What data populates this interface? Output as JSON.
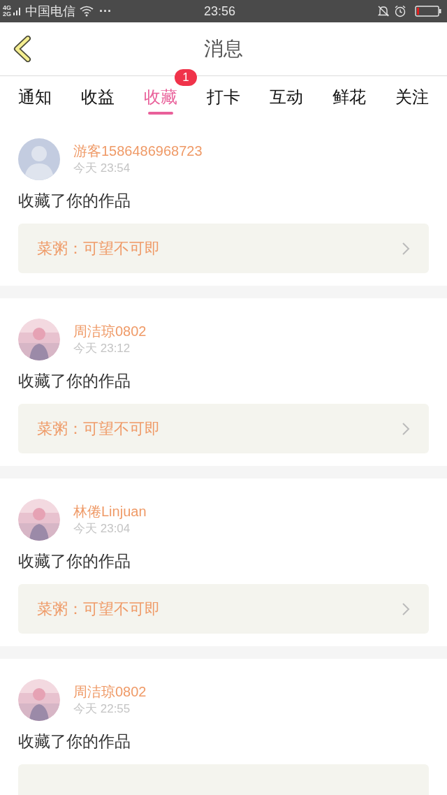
{
  "status_bar": {
    "network_top": "4G",
    "network_bottom": "2G",
    "carrier": "中国电信",
    "more": "···",
    "time": "23:56"
  },
  "header": {
    "title": "消息"
  },
  "tabs": [
    {
      "label": "通知",
      "selected": false
    },
    {
      "label": "收益",
      "selected": false
    },
    {
      "label": "收藏",
      "selected": true,
      "badge": "1"
    },
    {
      "label": "打卡",
      "selected": false
    },
    {
      "label": "互动",
      "selected": false
    },
    {
      "label": "鲜花",
      "selected": false
    },
    {
      "label": "关注",
      "selected": false
    }
  ],
  "messages": [
    {
      "avatar": {
        "kind": "default"
      },
      "name": "游客1586486968723",
      "time": "今天 23:54",
      "action": "收藏了你的作品",
      "work": "菜粥：可望不可即"
    },
    {
      "name": "周洁琼0802",
      "time": "今天 23:12",
      "action": "收藏了你的作品",
      "work": "菜粥：可望不可即"
    },
    {
      "name": "林倦Linjuan",
      "time": "今天 23:04",
      "action": "收藏了你的作品",
      "work": "菜粥：可望不可即"
    },
    {
      "name": "周洁琼0802",
      "time": "今天 22:55",
      "action": "收藏了你的作品"
    }
  ]
}
